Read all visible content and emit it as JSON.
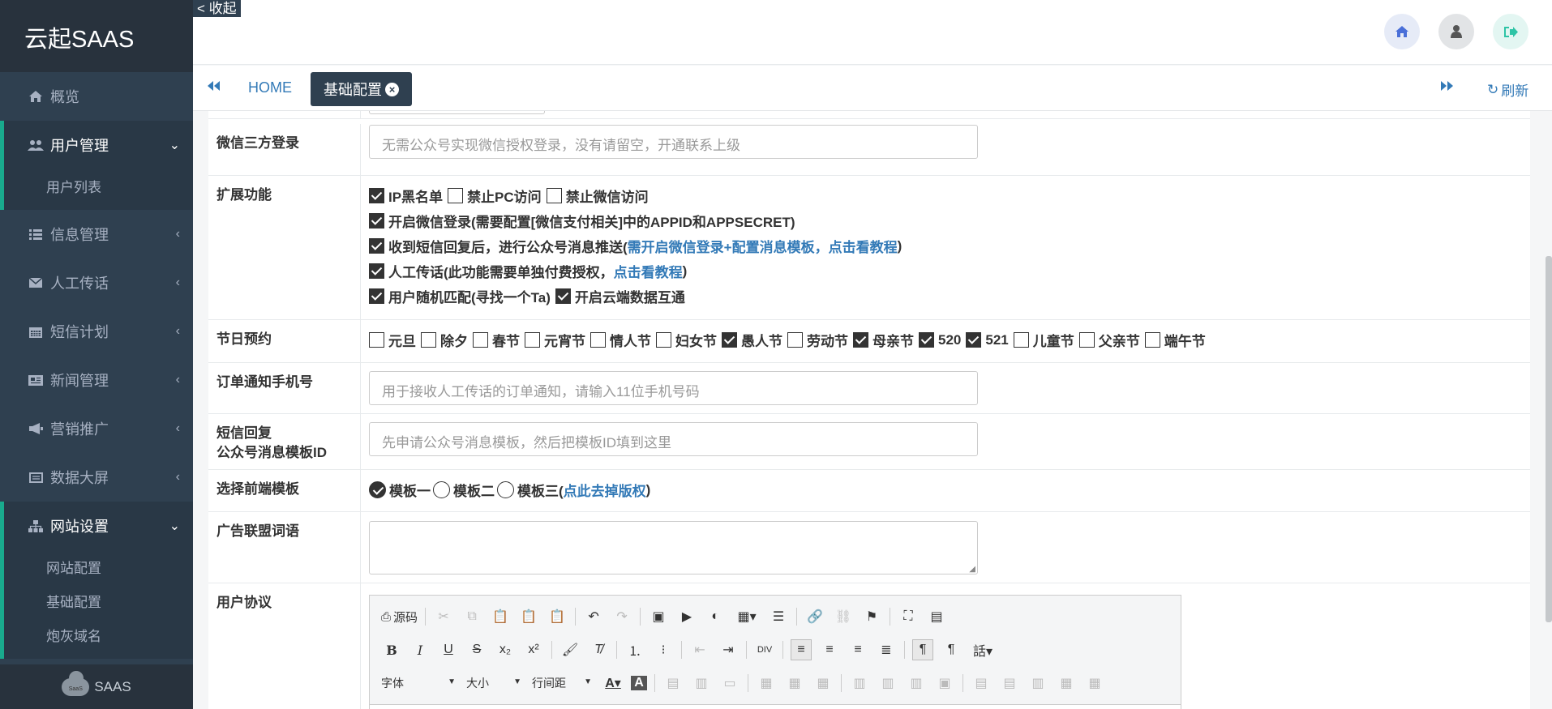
{
  "app": {
    "logo": "云起SAAS",
    "collapse": "< 收起",
    "footer": "SAAS",
    "footer_small": "SaaS"
  },
  "sidebar": {
    "items": [
      {
        "label": "概览",
        "icon": "home-icon"
      },
      {
        "label": "用户管理",
        "icon": "users-icon"
      },
      {
        "label": "信息管理",
        "icon": "list-icon"
      },
      {
        "label": "人工传话",
        "icon": "envelope-icon"
      },
      {
        "label": "短信计划",
        "icon": "calendar-icon"
      },
      {
        "label": "新闻管理",
        "icon": "newspaper-icon"
      },
      {
        "label": "营销推广",
        "icon": "megaphone-icon"
      },
      {
        "label": "数据大屏",
        "icon": "screen-icon"
      },
      {
        "label": "网站设置",
        "icon": "sitemap-icon"
      }
    ],
    "user_sub": [
      "用户列表"
    ],
    "site_sub": [
      "网站配置",
      "基础配置",
      "炮灰域名"
    ]
  },
  "tabs": {
    "home": "HOME",
    "active": "基础配置",
    "refresh": "刷新"
  },
  "form": {
    "wechat_login": {
      "label": "微信三方登录",
      "placeholder": "无需公众号实现微信授权登录，没有请留空，开通联系上级"
    },
    "ext": {
      "label": "扩展功能",
      "l1": [
        "IP黑名单",
        "禁止PC访问",
        "禁止微信访问"
      ],
      "l2": "开启微信登录(需要配置[微信支付相关]中的APPID和APPSECRET)",
      "l3a": "收到短信回复后，进行公众号消息推送(",
      "l3b": "需开启微信登录+配置消息模板，点击看教程",
      "l3c": ")",
      "l4a": "人工传话(此功能需要单独付费授权，",
      "l4b": "点击看教程",
      "l4c": ")",
      "l5": [
        "用户随机匹配(寻找一个Ta)",
        "开启云端数据互通"
      ]
    },
    "holiday": {
      "label": "节日预约",
      "items": [
        {
          "name": "元旦",
          "checked": false
        },
        {
          "name": "除夕",
          "checked": false
        },
        {
          "name": "春节",
          "checked": false
        },
        {
          "name": "元宵节",
          "checked": false
        },
        {
          "name": "情人节",
          "checked": false
        },
        {
          "name": "妇女节",
          "checked": false
        },
        {
          "name": "愚人节",
          "checked": true
        },
        {
          "name": "劳动节",
          "checked": false
        },
        {
          "name": "母亲节",
          "checked": true
        },
        {
          "name": "520",
          "checked": true
        },
        {
          "name": "521",
          "checked": true
        },
        {
          "name": "儿童节",
          "checked": false
        },
        {
          "name": "父亲节",
          "checked": false
        },
        {
          "name": "端午节",
          "checked": false
        }
      ]
    },
    "order_phone": {
      "label": "订单通知手机号",
      "placeholder": "用于接收人工传话的订单通知，请输入11位手机号码"
    },
    "sms_tpl": {
      "label1": "短信回复",
      "label2": "公众号消息模板ID",
      "placeholder": "先申请公众号消息模板，然后把模板ID填到这里"
    },
    "template": {
      "label": "选择前端模板",
      "opts": [
        "模板一",
        "模板二",
        "模板三("
      ],
      "link": "点此去掉版权",
      "end": ")"
    },
    "ad": {
      "label": "广告联盟词语"
    },
    "agreement": {
      "label": "用户协议"
    }
  },
  "editor": {
    "source": "源码",
    "font": "字体",
    "size": "大小",
    "line": "行间距"
  }
}
